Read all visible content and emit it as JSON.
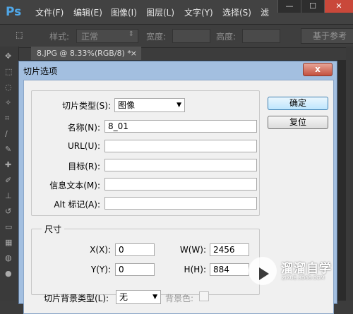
{
  "app": {
    "logo": "Ps",
    "menus": [
      "文件(F)",
      "编辑(E)",
      "图像(I)",
      "图层(L)",
      "文字(Y)",
      "选择(S)",
      "滤"
    ],
    "window_controls": [
      "—",
      "☐",
      "✕"
    ]
  },
  "options_bar": {
    "style_label": "样式:",
    "style_value": "正常",
    "width_label": "宽度:",
    "height_label": "高度:",
    "ref_button": "基于参考"
  },
  "document_tab": {
    "title": "8.JPG @ 8.33%(RGB/8) *",
    "close": "×"
  },
  "dialog": {
    "title": "切片选项",
    "close_label": "x",
    "slice_type_label": "切片类型(S):",
    "slice_type_value": "图像",
    "name_label": "名称(N):",
    "name_value": "8_01",
    "url_label": "URL(U):",
    "url_value": "",
    "target_label": "目标(R):",
    "target_value": "",
    "message_label": "信息文本(M):",
    "message_value": "",
    "alt_label": "Alt 标记(A):",
    "alt_value": "",
    "dimensions_legend": "尺寸",
    "x_label": "X(X):",
    "x_value": "0",
    "y_label": "Y(Y):",
    "y_value": "0",
    "w_label": "W(W):",
    "w_value": "2456",
    "h_label": "H(H):",
    "h_value": "884",
    "bg_type_label": "切片背景类型(L):",
    "bg_type_value": "无",
    "bg_color_label": "背景色:",
    "ok_button": "确定",
    "reset_button": "复位"
  },
  "watermark": {
    "name": "溜溜自学",
    "url": "ZIXUE.3D66.COM"
  },
  "colors": {
    "ps_dark": "#3c3c3c",
    "dialog_title_bar": "#a3bfe0",
    "close_red": "#c4503e",
    "ps_blue": "#4fa7e8"
  }
}
